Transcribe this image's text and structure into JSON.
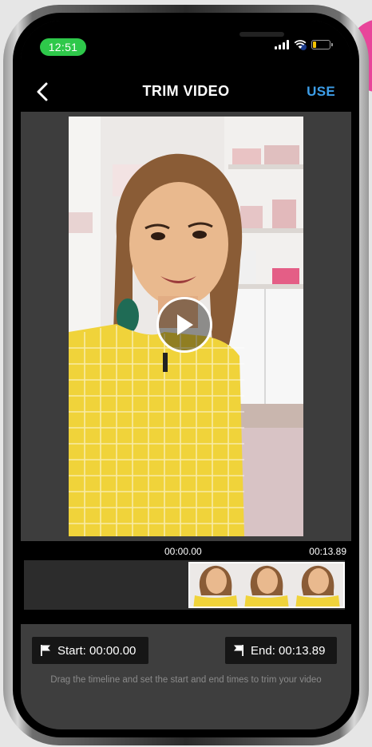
{
  "status_bar": {
    "time": "12:51",
    "battery_level": 0.2,
    "icons": [
      "signal-icon",
      "wifi-icon",
      "battery-icon"
    ]
  },
  "nav": {
    "back_icon": "chevron-left-icon",
    "title": "TRIM VIDEO",
    "use_label": "USE"
  },
  "video": {
    "play_icon": "play-icon"
  },
  "timeline": {
    "start_time": "00:00.00",
    "end_time": "00:13.89"
  },
  "controls": {
    "start_label": "Start: 00:00.00",
    "end_label": "End: 00:13.89",
    "hint": "Drag the timeline and set the start and end times to trim your video"
  },
  "colors": {
    "accent": "#3d9ee8",
    "time_pill": "#2ec84a",
    "battery": "#f5c400",
    "dress": "#f0d33a"
  }
}
